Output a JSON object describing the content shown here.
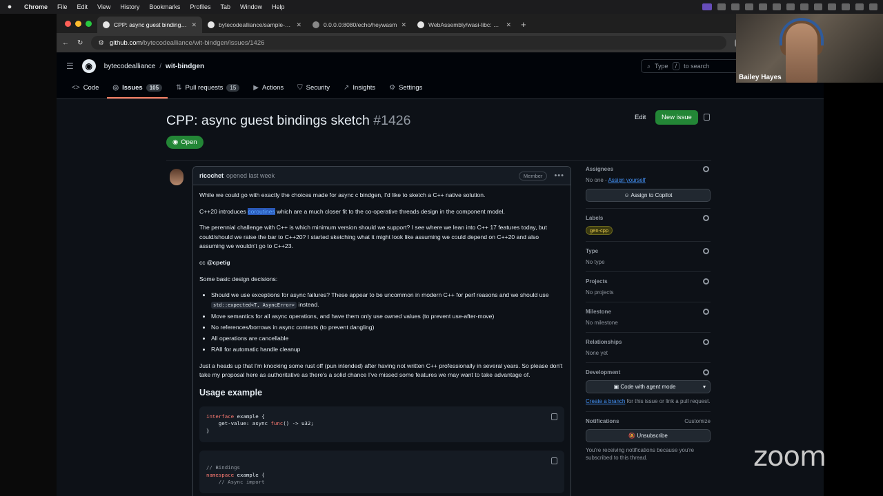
{
  "menubar": {
    "items": [
      "Chrome",
      "File",
      "Edit",
      "View",
      "History",
      "Bookmarks",
      "Profiles",
      "Tab",
      "Window",
      "Help"
    ]
  },
  "tabs": [
    {
      "label": "CPP: async guest bindings sk",
      "active": true
    },
    {
      "label": "bytecodealliance/sample-wa",
      "active": false
    },
    {
      "label": "0.0.0.0:8080/echo/heywasm",
      "active": false
    },
    {
      "label": "WebAssembly/wasi-libc: WA",
      "active": false
    }
  ],
  "address": {
    "host": "github.com",
    "path": "/bytecodealliance/wit-bindgen/issues/1426"
  },
  "github": {
    "owner": "bytecodealliance",
    "repo": "wit-bindgen",
    "search_prefix": "Type",
    "search_key": "/",
    "search_suffix": "to search",
    "nav": [
      {
        "label": "Code",
        "icon": "<>",
        "count": null,
        "active": false
      },
      {
        "label": "Issues",
        "icon": "◎",
        "count": "105",
        "active": true
      },
      {
        "label": "Pull requests",
        "icon": "⇅",
        "count": "15",
        "active": false
      },
      {
        "label": "Actions",
        "icon": "▶",
        "count": null,
        "active": false
      },
      {
        "label": "Security",
        "icon": "⛉",
        "count": null,
        "active": false
      },
      {
        "label": "Insights",
        "icon": "↗",
        "count": null,
        "active": false
      },
      {
        "label": "Settings",
        "icon": "⚙",
        "count": null,
        "active": false
      }
    ]
  },
  "issue": {
    "title": "CPP: async guest bindings sketch",
    "number": "#1426",
    "edit_label": "Edit",
    "new_issue_label": "New issue",
    "state": "Open"
  },
  "comment": {
    "author": "ricochet",
    "meta": "opened last week",
    "badge": "Member",
    "p1": "While we could go with exactly the choices made for async c bindgen, I'd like to sketch a C++ native solution.",
    "p2_pre": "C++20 introduces ",
    "p2_hl": "coroutines",
    "p2_post": " which are a much closer fit to the co-operative threads design in the component model.",
    "p3": "The perennial challenge with C++ is which minimum version should we support? I see where we lean into C++ 17 features today, but could/should we raise the bar to C++20? I started sketching what it might look like assuming we could depend on C++20 and also assuming we wouldn't go to C++23.",
    "cc_prefix": "cc ",
    "cc_mention": "@cpetig",
    "p4": "Some basic design decisions:",
    "b1_pre": "Should we use exceptions for async failures? These appear to be uncommon in modern C++ for perf reasons and we should use ",
    "b1_code": "std::expected<T, AsyncError>",
    "b1_post": " instead.",
    "b2": "Move semantics for all async operations, and have them only use owned values (to prevent use-after-move)",
    "b3": "No references/borrows in async contexts (to prevent dangling)",
    "b4": "All operations are cancellable",
    "b5": "RAII for automatic handle cleanup",
    "p5": "Just a heads up that I'm knocking some rust off (pun intended) after having not written C++ professionally in several years. So please don't take my proposal here as authoritative as there's a solid chance I've missed some features we may want to take advantage of.",
    "h_usage": "Usage example",
    "code1_l1_kw": "interface",
    "code1_l1": " example {",
    "code1_l2_pre": "    get-value: async ",
    "code1_l2_kw": "func",
    "code1_l2_post": "() -> u32;",
    "code1_l3": "}",
    "code2_l1": "// Bindings",
    "code2_l2_kw": "namespace",
    "code2_l2": " example {",
    "code2_l3": "    // Async import"
  },
  "sidebar": {
    "assignees_title": "Assignees",
    "assignees_none": "No one - ",
    "assign_yourself": "Assign yourself",
    "assign_copilot": "Assign to Copilot",
    "labels_title": "Labels",
    "label": "gen-cpp",
    "type_title": "Type",
    "type_value": "No type",
    "projects_title": "Projects",
    "projects_value": "No projects",
    "milestone_title": "Milestone",
    "milestone_value": "No milestone",
    "relationships_title": "Relationships",
    "relationships_value": "None yet",
    "development_title": "Development",
    "dev_button": "Code with agent mode",
    "dev_link": "Create a branch",
    "dev_note": " for this issue or link a pull request.",
    "notifications_title": "Notifications",
    "customize": "Customize",
    "unsubscribe": "Unsubscribe",
    "notif_note": "You're receiving notifications because you're subscribed to this thread."
  },
  "zoom": {
    "participant": "Bailey Hayes",
    "logo": "zoom"
  },
  "colors": {
    "accent_green": "#238636",
    "link_blue": "#4493f8",
    "tab_underline": "#f78166"
  }
}
